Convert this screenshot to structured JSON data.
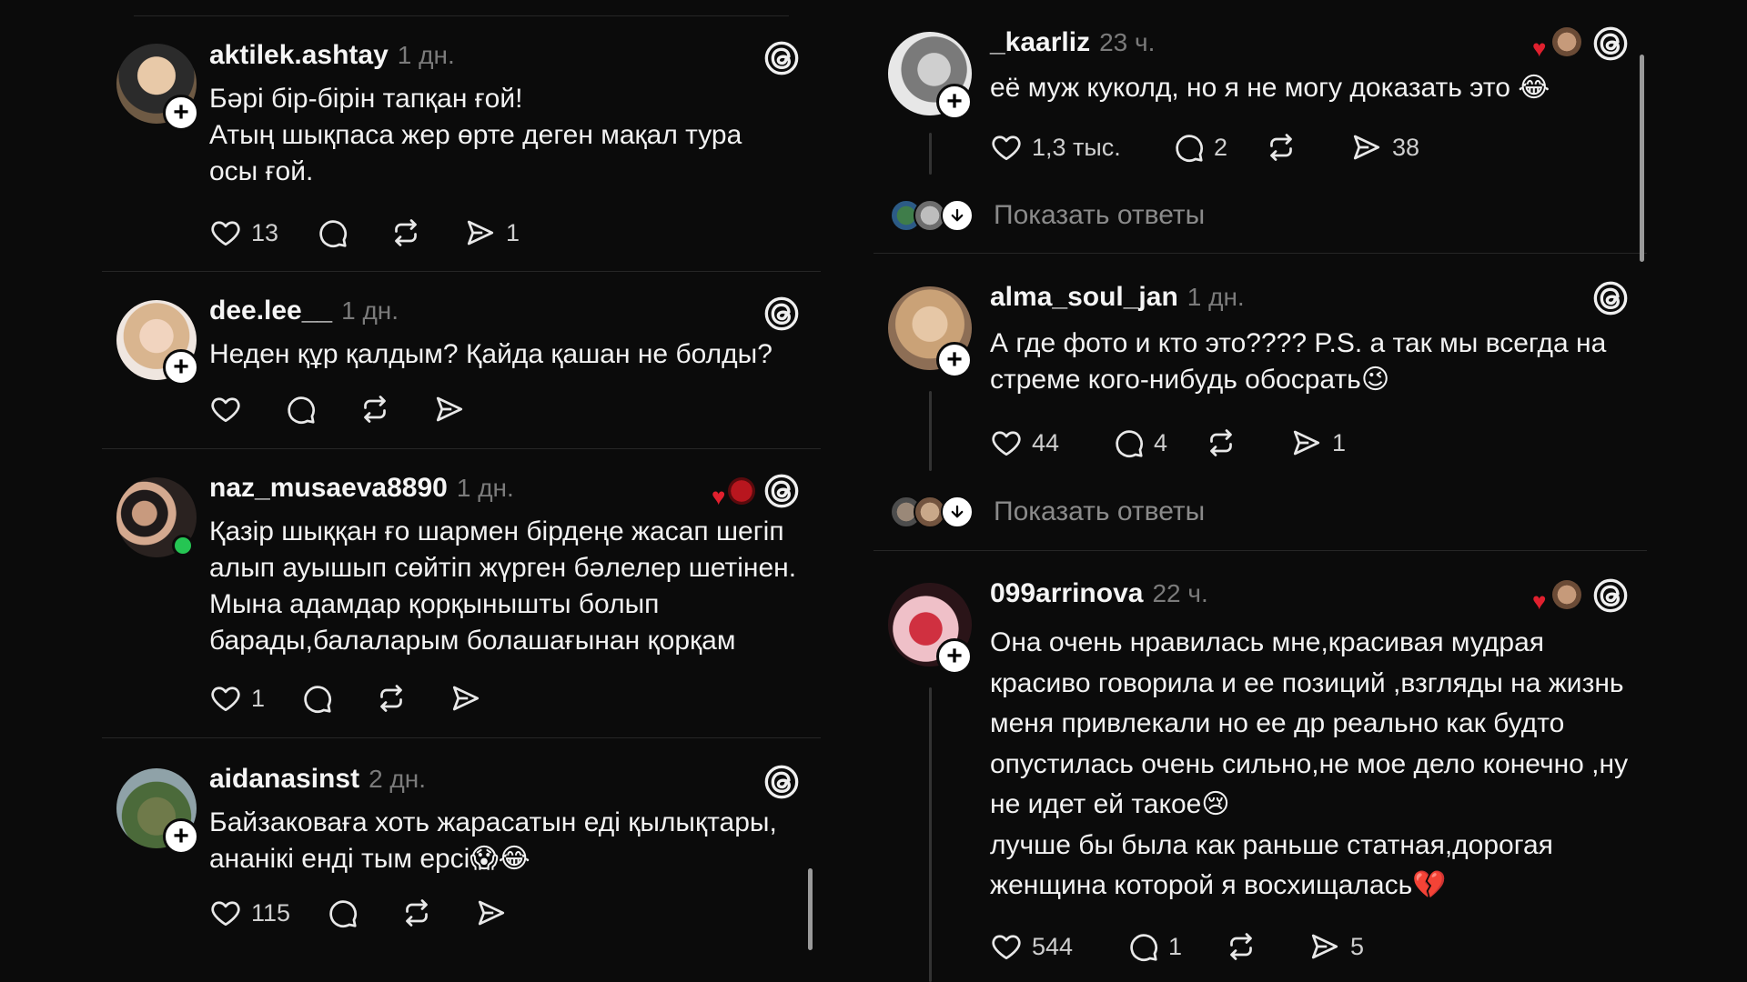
{
  "left": {
    "posts": [
      {
        "username": "aktilek.ashtay",
        "time": "1 дн.",
        "body": "Бәрі бір-бірін тапқан ғой!\nАтың шықпаса жер өрте деген мақал тура осы ғой.",
        "likes": "13",
        "comments": "",
        "reposts": "",
        "shares": "1"
      },
      {
        "username": "dee.lee__",
        "time": "1 дн.",
        "body": "Неден құр қалдым? Қайда қашан не болды?",
        "likes": "",
        "comments": "",
        "reposts": "",
        "shares": ""
      },
      {
        "username": "naz_musaeva8890",
        "time": "1 дн.",
        "body": "Қазір шыққан ғо шармен бірдеңе жасап шегіп алып ауышып сөйтіп жүрген бәлелер шетінен. Мына адамдар қорқынышты болып барады,балаларым болашағынан қорқам",
        "likes": "1",
        "comments": "",
        "reposts": "",
        "shares": ""
      },
      {
        "username": "aidanasinst",
        "time": "2 дн.",
        "body": "Байзаковаға хоть жарасатын еді қылықтары, ананікі енді тым ерсі😱😂",
        "likes": "115",
        "comments": "",
        "reposts": "",
        "shares": ""
      }
    ]
  },
  "right": {
    "posts": [
      {
        "username": "_kaarliz",
        "time": "23 ч.",
        "body": "её муж куколд, но я не могу доказать это 😂",
        "likes": "1,3 тыс.",
        "comments": "2",
        "reposts": "",
        "shares": "38",
        "show_replies": "Показать ответы"
      },
      {
        "username": "alma_soul_jan",
        "time": "1 дн.",
        "body": "А где фото и кто это???? P.S. а так мы всегда на стреме кого-нибудь обосрать😉",
        "likes": "44",
        "comments": "4",
        "reposts": "",
        "shares": "1",
        "show_replies": "Показать ответы"
      },
      {
        "username": "099arrinova",
        "time": "22 ч.",
        "body": "Она очень нравилась мне,красивая мудрая красиво говорила и ее позиций ,взгляды на жизнь меня привлекали но ее др реально как будто опустилась очень сильно,не мое дело конечно ,ну не идет ей такое😢\nлучше бы была как раньше статная,дорогая женщина которой я восхищалась💔",
        "likes": "544",
        "comments": "1",
        "reposts": "",
        "shares": "5"
      }
    ]
  },
  "colors": {
    "background": "#0b0b0b",
    "text": "#f3f3f3",
    "muted": "#7b7b7b",
    "heart_red": "#e0202e"
  },
  "icons": [
    "threads-icon",
    "heart-icon",
    "comment-icon",
    "repost-icon",
    "share-icon",
    "plus-icon",
    "arrow-down-icon"
  ]
}
